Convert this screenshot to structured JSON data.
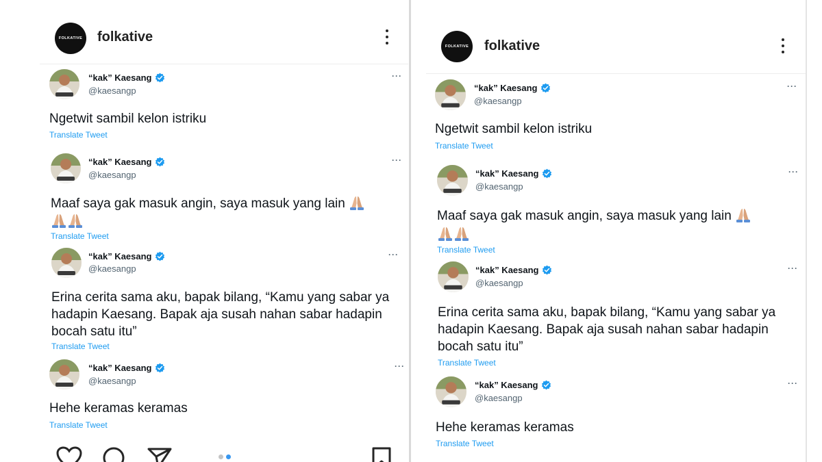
{
  "account": {
    "name": "folkative",
    "logo_text": "FOLKATIVE"
  },
  "tweets": [
    {
      "display_name": "“kak” Kaesang",
      "handle": "@kaesangp",
      "text": "Ngetwit sambil kelon istriku",
      "translate": "Translate Tweet"
    },
    {
      "display_name": "“kak” Kaesang",
      "handle": "@kaesangp",
      "text": "Maaf saya gak masuk angin, saya masuk yang lain",
      "translate": "Translate Tweet"
    },
    {
      "display_name": "“kak” Kaesang",
      "handle": "@kaesangp",
      "text": "Erina cerita sama aku, bapak bilang, “Kamu yang sabar ya hadapin Kaesang. Bapak aja susah nahan sabar hadapin bocah satu itu”",
      "translate": "Translate Tweet"
    },
    {
      "display_name": "“kak” Kaesang",
      "handle": "@kaesangp",
      "text": "Hehe keramas keramas",
      "translate": "Translate Tweet"
    }
  ],
  "icons": {
    "verified": "verified-badge-icon",
    "more": "more-options-icon",
    "emoji": "folded-hands-emoji",
    "actions": [
      "heart-icon",
      "comment-icon",
      "send-icon",
      "bookmark-icon"
    ]
  },
  "colors": {
    "verified_blue": "#1d9bf0",
    "translate_link": "#1d9bf0",
    "handle_gray": "#536471",
    "carousel_active": "#3897f0"
  },
  "carousel": {
    "total": 2,
    "active": 2
  }
}
